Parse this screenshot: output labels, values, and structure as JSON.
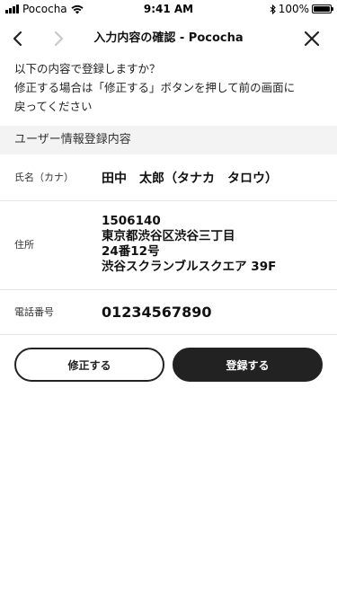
{
  "status_bar": {
    "carrier": "Pococha",
    "time": "9:41 AM",
    "battery_percent": "100%"
  },
  "nav": {
    "title": "入力内容の確認 - Pococha",
    "back_icon": "chevron-left-icon",
    "forward_icon": "chevron-right-icon",
    "close_icon": "close-icon",
    "forward_enabled": false
  },
  "intro": {
    "lines": [
      "以下の内容で登録しますか？",
      "修正する場合は「修正する」ボタンを押して前の画面に",
      "戻ってください"
    ]
  },
  "section": {
    "title": "ユーザー情報登録内容"
  },
  "fields": {
    "name": {
      "label": "氏名（カナ）",
      "value": "田中　太郎（タナカ　タロウ）"
    },
    "address": {
      "label": "住所",
      "lines": [
        "1506140",
        "東京都渋谷区渋谷三丁目",
        "24番12号",
        "渋谷スクランブルスクエア 39F"
      ]
    },
    "phone": {
      "label": "電話番号",
      "value": "01234567890"
    }
  },
  "buttons": {
    "edit_label": "修正する",
    "register_label": "登録する"
  },
  "colors": {
    "primary": "#222222",
    "section_bg": "#f3f3f3",
    "divider": "#e6e6e6",
    "disabled_icon": "#c8c8c8"
  }
}
